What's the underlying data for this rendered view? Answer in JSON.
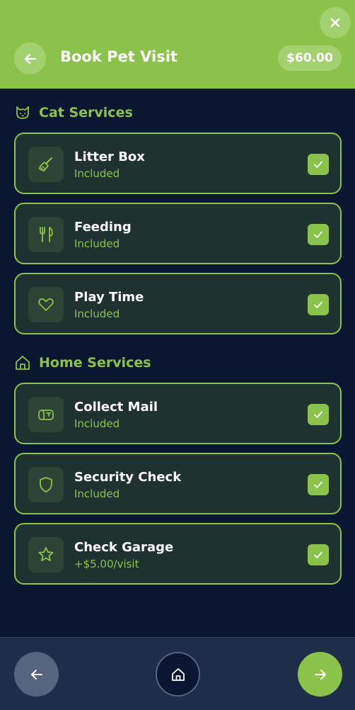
{
  "header": {
    "title": "Book Pet Visit",
    "price": "$60.00"
  },
  "colors": {
    "accent": "#8bc34a",
    "background": "#0b1630",
    "card_bg": "#1f3230",
    "bottom_bar": "#1d2d4a"
  },
  "sections": [
    {
      "label": "Cat Services",
      "icon": "cat-icon",
      "items": [
        {
          "name": "Litter Box",
          "status": "Included",
          "icon": "broom-icon",
          "checked": true
        },
        {
          "name": "Feeding",
          "status": "Included",
          "icon": "utensils-icon",
          "checked": true
        },
        {
          "name": "Play Time",
          "status": "Included",
          "icon": "heart-icon",
          "checked": true
        }
      ]
    },
    {
      "label": "Home Services",
      "icon": "home-icon",
      "items": [
        {
          "name": "Collect Mail",
          "status": "Included",
          "icon": "mailbox-icon",
          "checked": true
        },
        {
          "name": "Security Check",
          "status": "Included",
          "icon": "shield-icon",
          "checked": true
        },
        {
          "name": "Check Garage",
          "status": "+$5.00/visit",
          "icon": "star-icon",
          "checked": true
        }
      ]
    }
  ],
  "bottom_nav": {
    "back_icon": "arrow-left-icon",
    "home_icon": "home-icon",
    "next_icon": "arrow-right-icon"
  }
}
